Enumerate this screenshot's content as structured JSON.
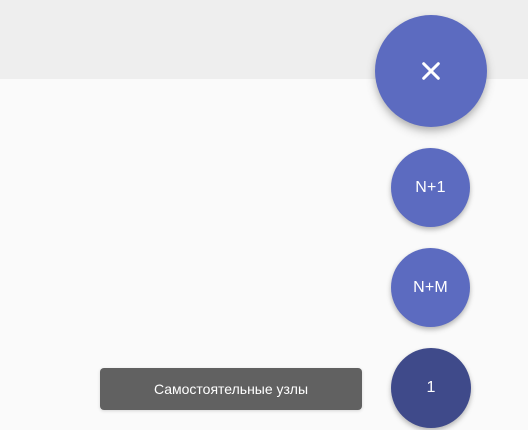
{
  "speed_dial": {
    "main_button": {
      "icon": "close-icon",
      "color": "#5c6bc0"
    },
    "actions": [
      {
        "label": "N+1",
        "color": "#5c6bc0"
      },
      {
        "label": "N+M",
        "color": "#5c6bc0"
      },
      {
        "label": "1",
        "color": "#3f4a8a",
        "tooltip": "Самостоятельные узлы"
      }
    ]
  },
  "colors": {
    "top_bar": "#eeeeee",
    "content_bg": "#fafafa",
    "tooltip_bg": "#616161"
  }
}
